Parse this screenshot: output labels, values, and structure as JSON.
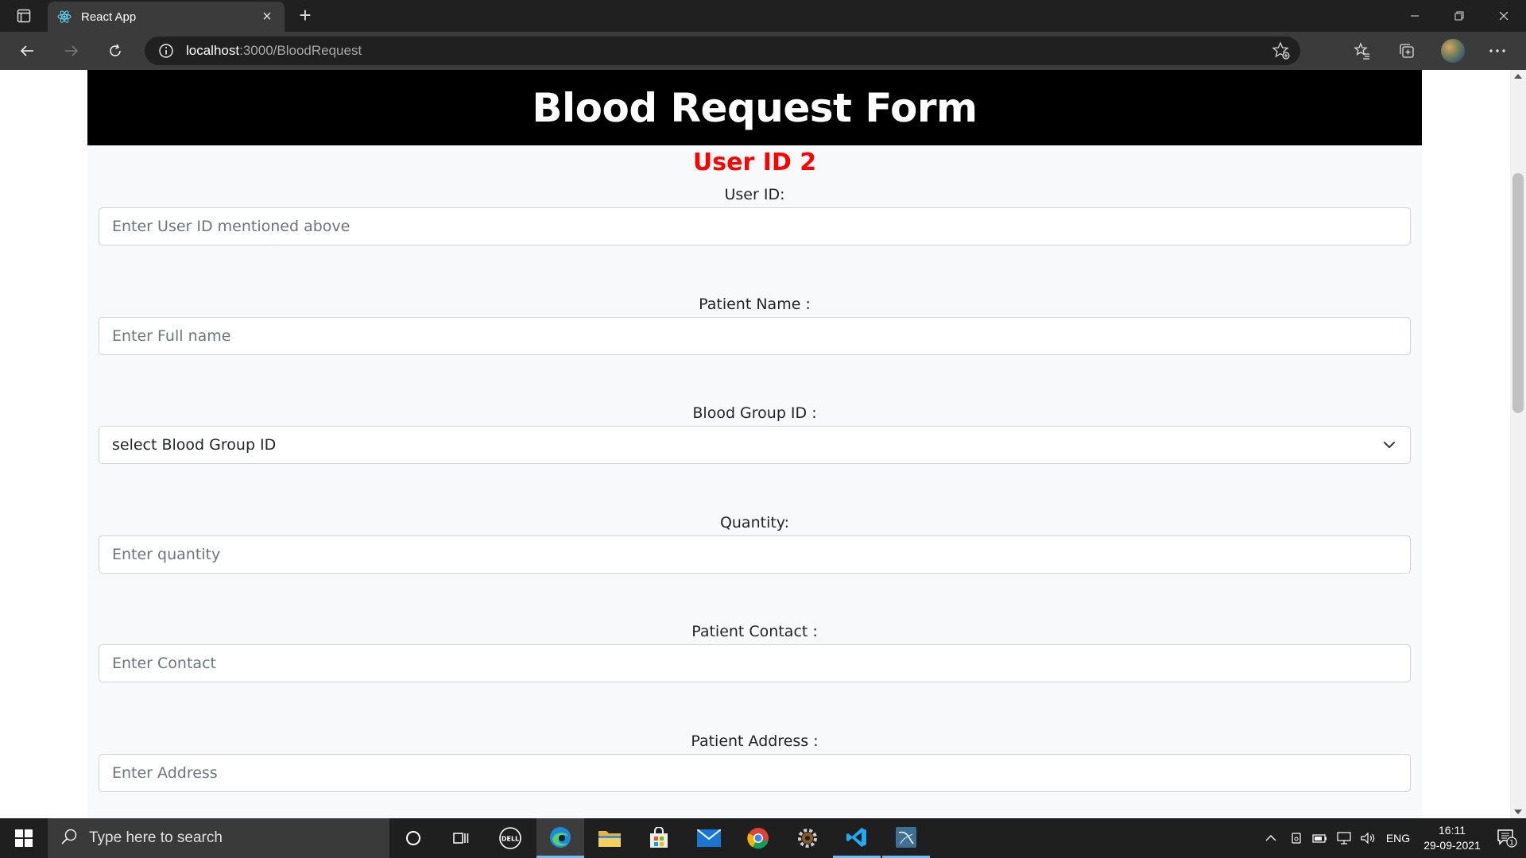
{
  "browser": {
    "tab_title": "React App",
    "url_host": "localhost",
    "url_path": ":3000/BloodRequest"
  },
  "page": {
    "title": "Blood Request Form",
    "user_id_heading": "User ID 2",
    "fields": [
      {
        "label": "User ID:",
        "placeholder": "Enter User ID mentioned above",
        "type": "input"
      },
      {
        "label": "Patient Name :",
        "placeholder": "Enter Full name",
        "type": "input"
      },
      {
        "label": "Blood Group ID :",
        "value": "select Blood Group ID",
        "type": "select"
      },
      {
        "label": "Quantity:",
        "placeholder": "Enter quantity",
        "type": "input"
      },
      {
        "label": "Patient Contact :",
        "placeholder": "Enter Contact",
        "type": "input"
      },
      {
        "label": "Patient Address :",
        "placeholder": "Enter Address",
        "type": "input"
      }
    ]
  },
  "taskbar": {
    "search_placeholder": "Type here to search",
    "language": "ENG",
    "time": "16:11",
    "date": "29-09-2021",
    "notification_count": "1"
  },
  "colors": {
    "header_bg": "#000000",
    "user_id_color": "#ff0000",
    "card_bg": "#f8f9fa"
  }
}
